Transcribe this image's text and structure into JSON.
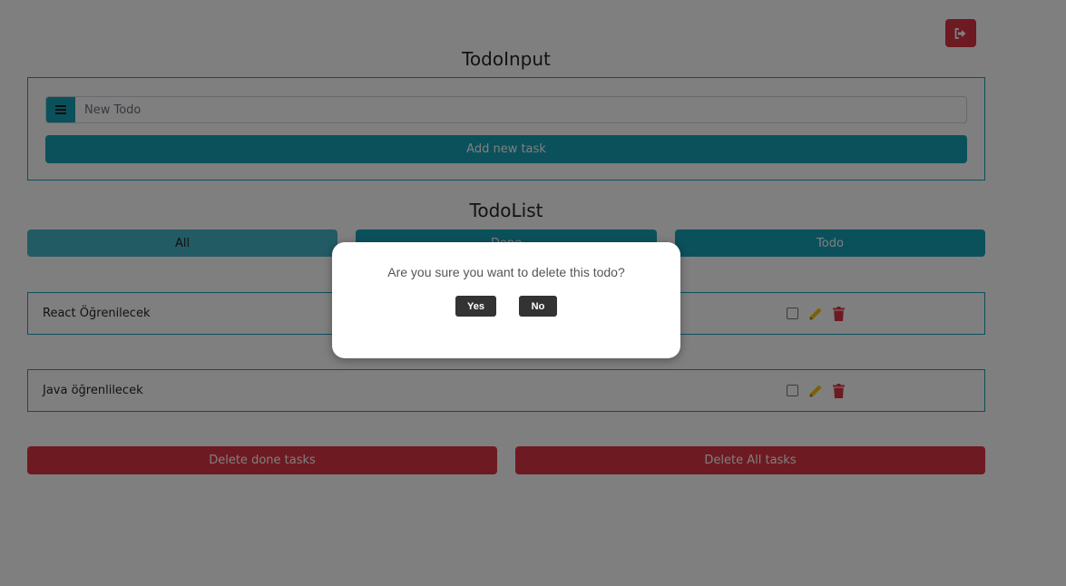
{
  "header": {
    "logout_icon": "sign-out-icon"
  },
  "todo_input": {
    "title": "TodoInput",
    "placeholder": "New Todo",
    "value": "",
    "prepend_icon": "list-icon",
    "add_button_label": "Add new task"
  },
  "todo_list": {
    "title": "TodoList",
    "filters": [
      {
        "label": "All"
      },
      {
        "label": "Done"
      },
      {
        "label": "Todo"
      }
    ],
    "items": [
      {
        "text": "React Öğrenilecek",
        "done": false
      },
      {
        "text": "Java öğrenlilecek",
        "done": false
      }
    ],
    "delete_done_label": "Delete done tasks",
    "delete_all_label": "Delete All tasks"
  },
  "modal": {
    "message": "Are you sure you want to delete this todo?",
    "yes_label": "Yes",
    "no_label": "No"
  },
  "colors": {
    "info": "#17a2b8",
    "danger": "#dc3545",
    "edit": "#ffc107",
    "modal_button": "#333333"
  }
}
